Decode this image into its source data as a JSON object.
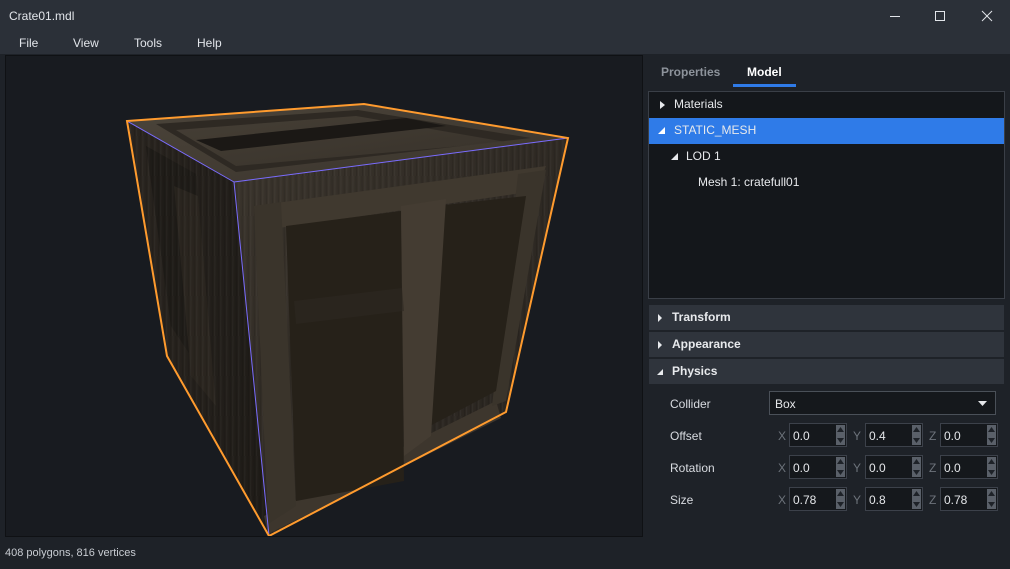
{
  "window": {
    "title": "Crate01.mdl"
  },
  "menu": [
    "File",
    "View",
    "Tools",
    "Help"
  ],
  "viewport": {
    "status": "408 polygons, 816 vertices",
    "selection_color": "#ff9b2e"
  },
  "tabs": [
    {
      "label": "Properties",
      "active": false
    },
    {
      "label": "Model",
      "active": true
    }
  ],
  "tree": [
    {
      "label": "Materials",
      "expanded": false,
      "selected": false
    },
    {
      "label": "STATIC_MESH",
      "expanded": true,
      "selected": true
    },
    {
      "label": "LOD 1",
      "expanded": true,
      "selected": false
    },
    {
      "label": "Mesh 1: cratefull01",
      "selected": false
    }
  ],
  "sections": [
    {
      "label": "Transform",
      "expanded": false
    },
    {
      "label": "Appearance",
      "expanded": false
    },
    {
      "label": "Physics",
      "expanded": true
    }
  ],
  "physics": {
    "collider_label": "Collider",
    "collider_value": "Box",
    "offset_label": "Offset",
    "rotation_label": "Rotation",
    "size_label": "Size",
    "axes": [
      "X",
      "Y",
      "Z"
    ],
    "offset": [
      "0.0",
      "0.4",
      "0.0"
    ],
    "rotation": [
      "0.0",
      "0.0",
      "0.0"
    ],
    "size": [
      "0.78",
      "0.8",
      "0.78"
    ]
  },
  "colors": {
    "accent": "#2f7be8",
    "background": "#1e2228"
  }
}
